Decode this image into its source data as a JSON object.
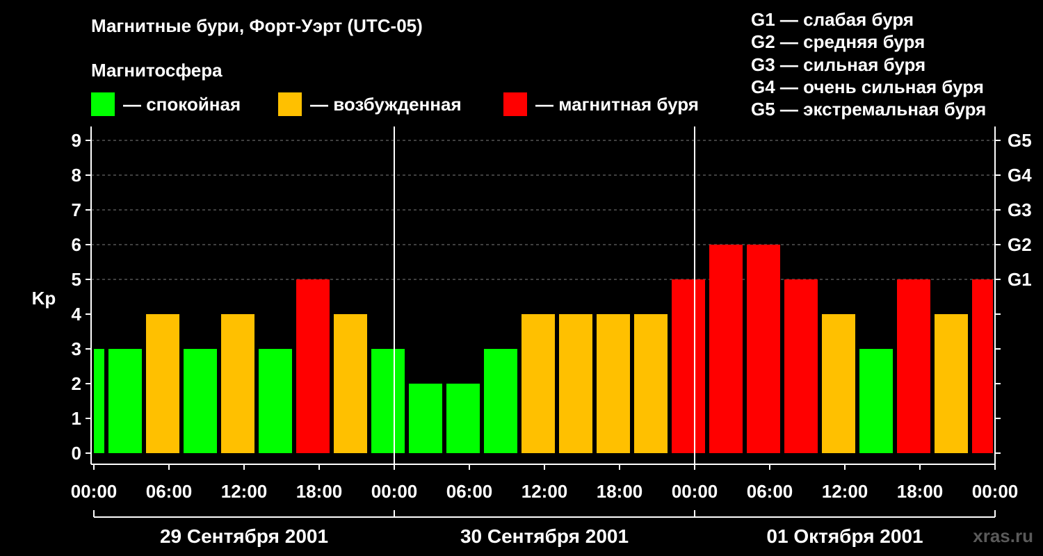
{
  "title": "Магнитные бури, Форт-Уэрт (UTC-05)",
  "subtitle": "Магнитосфера",
  "legend": [
    {
      "label": "— спокойная",
      "color": "#00ff00"
    },
    {
      "label": "— возбужденная",
      "color": "#ffc000"
    },
    {
      "label": "— магнитная буря",
      "color": "#ff0000"
    }
  ],
  "storm_levels": [
    "G1 — слабая буря",
    "G2 — средняя буря",
    "G3 — сильная буря",
    "G4 — очень сильная буря",
    "G5 — экстремальная буря"
  ],
  "watermark": "xras.ru",
  "colors": {
    "quiet": "#00ff00",
    "disturbed": "#ffc000",
    "storm": "#ff0000",
    "grid": "#808080",
    "axis": "#ffffff"
  },
  "chart_data": {
    "type": "bar",
    "ylabel": "Kp",
    "ylim": [
      0,
      9
    ],
    "yticks": [
      "0",
      "1",
      "2",
      "3",
      "4",
      "5",
      "6",
      "7",
      "8",
      "9"
    ],
    "right_ticks": [
      {
        "kp": 5,
        "label": "G1"
      },
      {
        "kp": 6,
        "label": "G2"
      },
      {
        "kp": 7,
        "label": "G3"
      },
      {
        "kp": 8,
        "label": "G4"
      },
      {
        "kp": 9,
        "label": "G5"
      }
    ],
    "grid": "dashed, at Kp 5–9",
    "x_range_hours": [
      0,
      72
    ],
    "xticks": [
      "00:00",
      "06:00",
      "12:00",
      "18:00",
      "00:00",
      "06:00",
      "12:00",
      "18:00",
      "00:00",
      "06:00",
      "12:00",
      "18:00",
      "00:00"
    ],
    "days": [
      "29 Сентября 2001",
      "30 Сентября 2001",
      "01 Октября 2001"
    ],
    "bars": [
      {
        "start_h": 0,
        "end_h": 1,
        "kp": 3,
        "state": "quiet"
      },
      {
        "start_h": 1,
        "end_h": 4,
        "kp": 3,
        "state": "quiet"
      },
      {
        "start_h": 4,
        "end_h": 7,
        "kp": 4,
        "state": "disturbed"
      },
      {
        "start_h": 7,
        "end_h": 10,
        "kp": 3,
        "state": "quiet"
      },
      {
        "start_h": 10,
        "end_h": 13,
        "kp": 4,
        "state": "disturbed"
      },
      {
        "start_h": 13,
        "end_h": 16,
        "kp": 3,
        "state": "quiet"
      },
      {
        "start_h": 16,
        "end_h": 19,
        "kp": 5,
        "state": "storm"
      },
      {
        "start_h": 19,
        "end_h": 22,
        "kp": 4,
        "state": "disturbed"
      },
      {
        "start_h": 22,
        "end_h": 25,
        "kp": 3,
        "state": "quiet"
      },
      {
        "start_h": 25,
        "end_h": 28,
        "kp": 2,
        "state": "quiet"
      },
      {
        "start_h": 28,
        "end_h": 31,
        "kp": 2,
        "state": "quiet"
      },
      {
        "start_h": 31,
        "end_h": 34,
        "kp": 3,
        "state": "quiet"
      },
      {
        "start_h": 34,
        "end_h": 37,
        "kp": 4,
        "state": "disturbed"
      },
      {
        "start_h": 37,
        "end_h": 40,
        "kp": 4,
        "state": "disturbed"
      },
      {
        "start_h": 40,
        "end_h": 43,
        "kp": 4,
        "state": "disturbed"
      },
      {
        "start_h": 43,
        "end_h": 46,
        "kp": 4,
        "state": "disturbed"
      },
      {
        "start_h": 46,
        "end_h": 49,
        "kp": 5,
        "state": "storm"
      },
      {
        "start_h": 49,
        "end_h": 52,
        "kp": 6,
        "state": "storm"
      },
      {
        "start_h": 52,
        "end_h": 55,
        "kp": 6,
        "state": "storm"
      },
      {
        "start_h": 55,
        "end_h": 58,
        "kp": 5,
        "state": "storm"
      },
      {
        "start_h": 58,
        "end_h": 61,
        "kp": 4,
        "state": "disturbed"
      },
      {
        "start_h": 61,
        "end_h": 64,
        "kp": 3,
        "state": "quiet"
      },
      {
        "start_h": 64,
        "end_h": 67,
        "kp": 5,
        "state": "storm"
      },
      {
        "start_h": 67,
        "end_h": 70,
        "kp": 4,
        "state": "disturbed"
      },
      {
        "start_h": 70,
        "end_h": 72,
        "kp": 5,
        "state": "storm"
      }
    ]
  }
}
